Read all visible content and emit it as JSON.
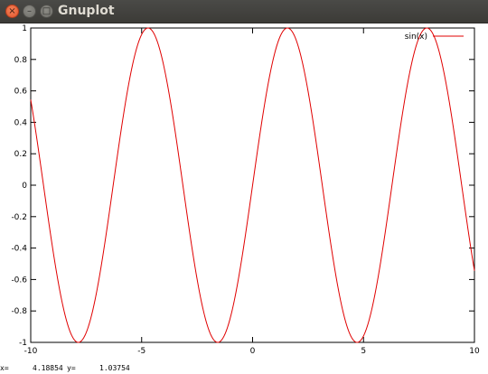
{
  "window": {
    "title": "Gnuplot",
    "close_glyph": "×",
    "min_glyph": "–",
    "max_glyph": "□"
  },
  "chart_data": {
    "type": "line",
    "function": "sin(x)",
    "xlim": [
      -10,
      10
    ],
    "ylim": [
      -1,
      1
    ],
    "xticks": [
      -10,
      -5,
      0,
      5,
      10
    ],
    "yticks": [
      1,
      0.8,
      0.6,
      0.4,
      0.2,
      0,
      -0.2,
      -0.4,
      -0.6,
      -0.8,
      -1
    ],
    "xtick_labels": [
      "-10",
      "-5",
      "0",
      "5",
      "10"
    ],
    "ytick_labels": [
      "1",
      "0.8",
      "0.6",
      "0.4",
      "0.2",
      "0",
      "-0.2",
      "-0.4",
      "-0.6",
      "-0.8",
      "-1"
    ],
    "series": [
      {
        "name": "sin(x)",
        "color": "#e00000"
      }
    ],
    "legend": {
      "position": "top-right"
    },
    "grid": false
  },
  "status": {
    "x_label": "x=",
    "x_value": "4.18854",
    "y_label": "y=",
    "y_value": "1.03754"
  }
}
